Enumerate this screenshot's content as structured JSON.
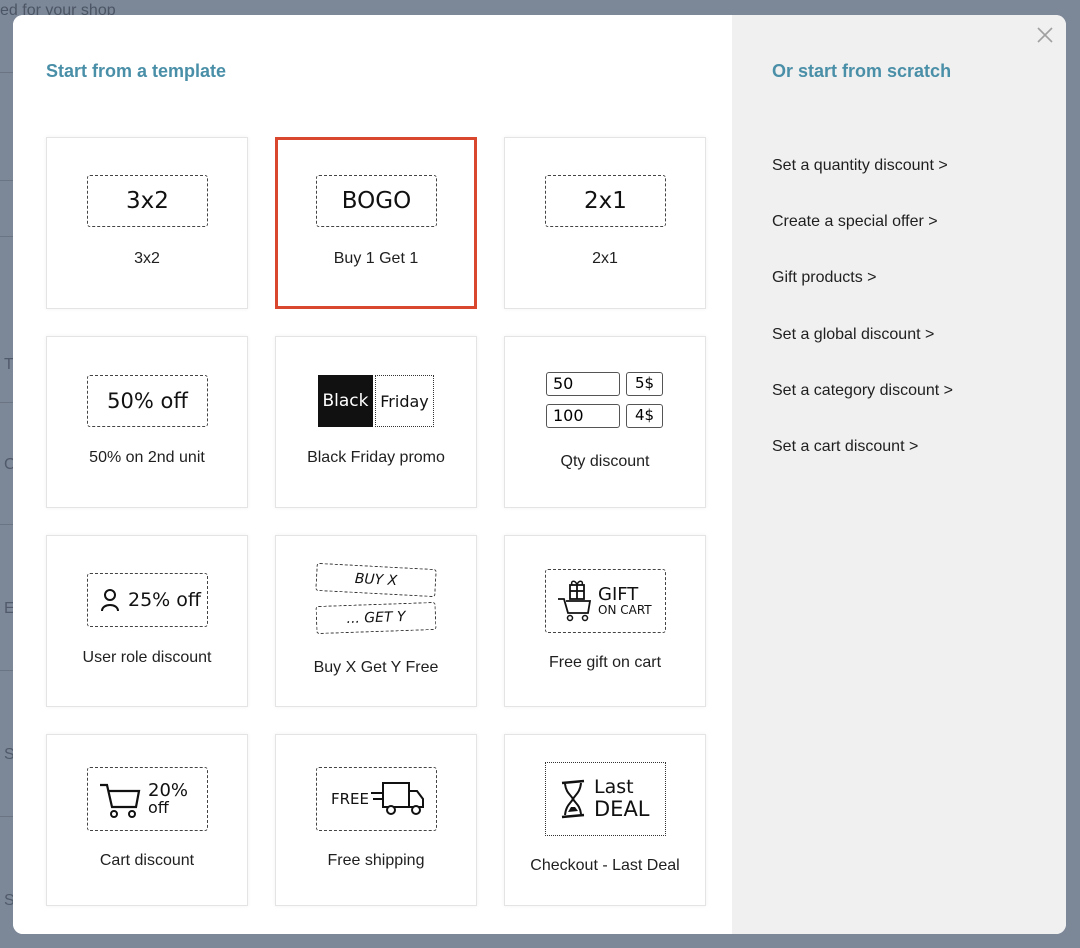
{
  "backdrop": {
    "fragment_top": "ed for your shop",
    "side_letters": [
      "T",
      "C",
      "E",
      "S",
      "S"
    ]
  },
  "modal": {
    "left_title": "Start from a template",
    "right_title": "Or start from scratch",
    "close_icon": "close-icon"
  },
  "templates": [
    {
      "label": "3x2",
      "badge": "3x2",
      "icon": "text-badge"
    },
    {
      "label": "Buy 1 Get 1",
      "badge": "BOGO",
      "icon": "text-badge",
      "selected": true
    },
    {
      "label": "2x1",
      "badge": "2x1",
      "icon": "text-badge"
    },
    {
      "label": "50% on 2nd unit",
      "badge": "50% off",
      "icon": "text-badge"
    },
    {
      "label": "Black Friday promo",
      "badge_left": "Black",
      "badge_right": "Friday",
      "icon": "black-friday-badge"
    },
    {
      "label": "Qty discount",
      "rows": [
        [
          "50",
          "5$"
        ],
        [
          "100",
          "4$"
        ]
      ],
      "icon": "qty-table"
    },
    {
      "label": "User role discount",
      "badge": "25% off",
      "icon": "user-icon"
    },
    {
      "label": "Buy X Get Y Free",
      "badge_top": "BUY X",
      "badge_bottom": "... GET Y",
      "icon": "tickets-badge"
    },
    {
      "label": "Free gift on cart",
      "badge_top": "GIFT",
      "badge_bottom": "ON CART",
      "icon": "gift-cart-icon"
    },
    {
      "label": "Cart discount",
      "badge_top": "20%",
      "badge_bottom": "off",
      "icon": "cart-icon"
    },
    {
      "label": "Free shipping",
      "badge": "FREE",
      "icon": "truck-icon"
    },
    {
      "label": "Checkout - Last Deal",
      "badge_top": "Last",
      "badge_bottom": "DEAL",
      "icon": "hourglass-icon"
    }
  ],
  "scratch_links": [
    "Set a quantity discount >",
    "Create a special offer >",
    "Gift products >",
    "Set a global discount >",
    "Set a category discount >",
    "Set a cart discount >"
  ],
  "colors": {
    "accent_title": "#4a8fa8",
    "selected_border": "#d9472f",
    "overlay": "#7c8798"
  }
}
